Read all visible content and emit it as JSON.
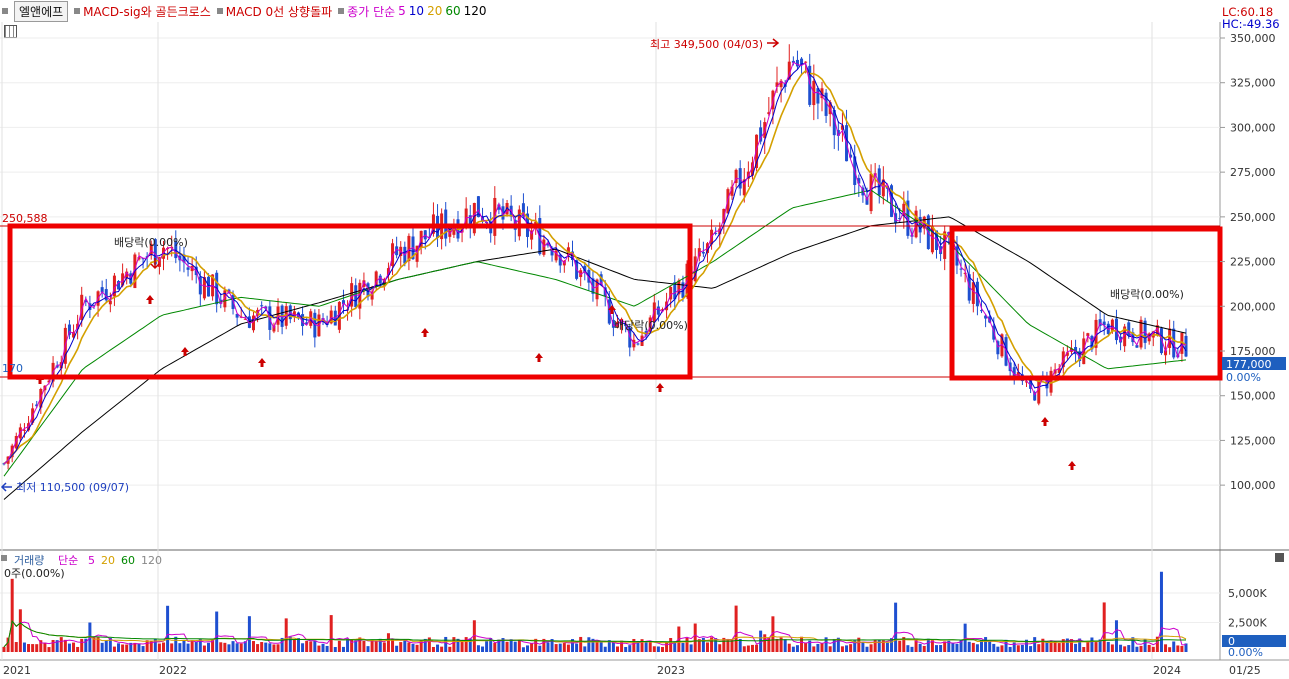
{
  "header": {
    "stock_name": "엘앤에프",
    "indicators": [
      {
        "label": "MACD-sig와 골든크로스",
        "color": "#cc0000"
      },
      {
        "label": "MACD 0선 상향돌파",
        "color": "#cc0000"
      }
    ],
    "ma_prefix": "종가 단순",
    "ma_periods": [
      {
        "label": "5",
        "color": "#cc00cc"
      },
      {
        "label": "10",
        "color": "#0000cc"
      },
      {
        "label": "20",
        "color": "#d4a000"
      },
      {
        "label": "60",
        "color": "#008800"
      },
      {
        "label": "120",
        "color": "#000000"
      }
    ],
    "lc": "LC:60.18",
    "hc": "HC:-49.36"
  },
  "price_panel": {
    "axis_labels": [
      "350,000",
      "325,000",
      "300,000",
      "275,000",
      "250,000",
      "225,000",
      "200,000",
      "175,000",
      "150,000",
      "125,000",
      "100,000"
    ],
    "current_price": "177,000",
    "current_pct": "0.00%",
    "level_250": "250,588",
    "level_170": "170",
    "high_label": "최고 349,500 (04/03)",
    "low_label": "최저 110,500 (09/07)",
    "div_labels": [
      "배당락(0.00%)",
      "배당락(0.00%)",
      "배당락(0.00%)"
    ]
  },
  "volume_panel": {
    "title_prefix": "거래량",
    "ma_prefix": "단순",
    "ma_periods": [
      {
        "label": "5",
        "color": "#cc00cc"
      },
      {
        "label": "20",
        "color": "#d4a000"
      },
      {
        "label": "60",
        "color": "#008800"
      },
      {
        "label": "120",
        "color": "#888888"
      }
    ],
    "info": "0주(0.00%)",
    "axis_labels": [
      "5,000K",
      "2,500K",
      "0.00%"
    ],
    "current_box": "0"
  },
  "x_axis": {
    "labels": [
      "2021",
      "2022",
      "2023",
      "2024",
      "01/25"
    ]
  },
  "chart_data": {
    "type": "candlestick",
    "price_range": [
      85000,
      360000
    ],
    "volume_range": [
      0,
      7000000
    ],
    "key_points": {
      "high": {
        "date": "04/03",
        "value": 349500
      },
      "low": {
        "date": "09/07",
        "value": 110500
      },
      "resistance": 250588,
      "current": 177000
    },
    "x_dates": [
      "2021",
      "2021.04",
      "2021.07",
      "2021.10",
      "2022",
      "2022.04",
      "2022.07",
      "2022.10",
      "2023",
      "2023.04",
      "2023.07",
      "2023.10",
      "2024",
      "2024.01"
    ],
    "close_path": [
      112000,
      200000,
      235000,
      195000,
      190000,
      230000,
      255000,
      235000,
      180000,
      235000,
      340000,
      265000,
      230000,
      150000,
      190000,
      177000
    ],
    "ma120_path": [
      92000,
      130000,
      165000,
      190000,
      202000,
      215000,
      225000,
      232000,
      215000,
      210000,
      230000,
      245000,
      250000,
      225000,
      195000,
      185000
    ],
    "ma60_path": [
      105000,
      165000,
      195000,
      205000,
      200000,
      215000,
      225000,
      215000,
      200000,
      225000,
      255000,
      265000,
      235000,
      190000,
      165000,
      170000
    ],
    "ma20_path": [
      110000,
      190000,
      230000,
      200000,
      190000,
      230000,
      245000,
      225000,
      185000,
      230000,
      320000,
      260000,
      235000,
      160000,
      170000,
      195000
    ],
    "boxes": [
      {
        "date_start": "2021.01",
        "date_end": "2023.01",
        "price_top": 251000,
        "price_bottom": 170000
      },
      {
        "date_start": "2023.10",
        "date_end": "2024.01",
        "price_top": 250000,
        "price_bottom": 170000
      }
    ]
  }
}
